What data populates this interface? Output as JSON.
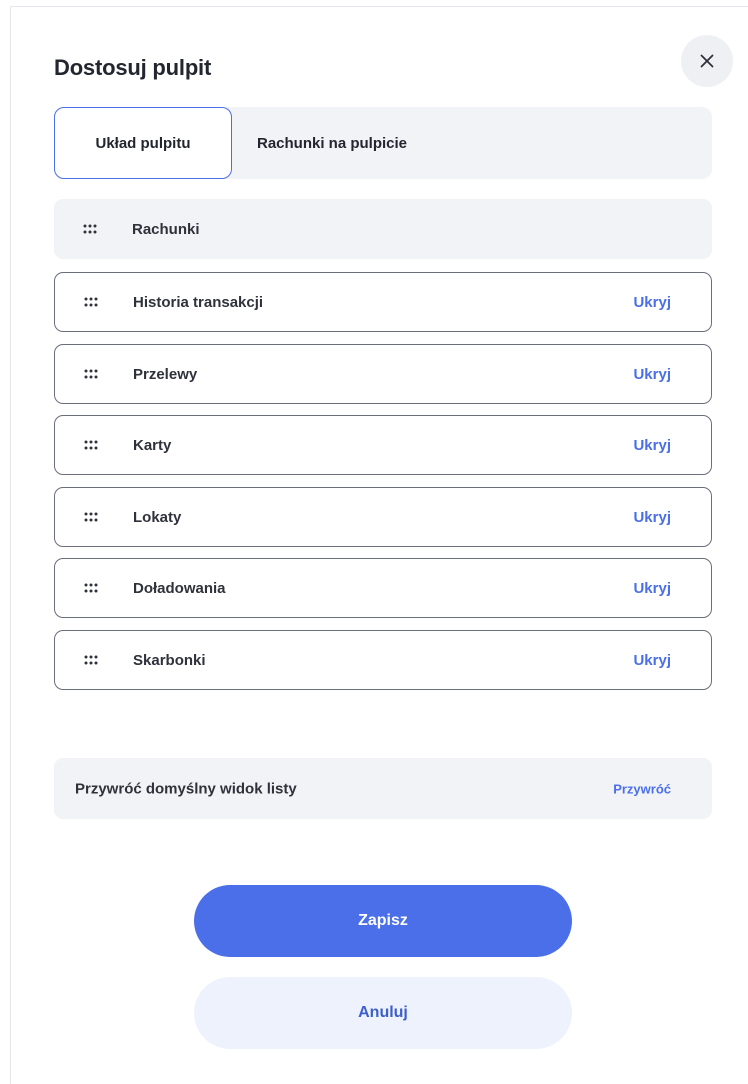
{
  "dialog": {
    "title": "Dostosuj pulpit"
  },
  "tabs": [
    {
      "label": "Układ pulpitu",
      "active": true
    },
    {
      "label": "Rachunki na pulpicie",
      "active": false
    }
  ],
  "widgets": {
    "fixed": {
      "label": "Rachunki"
    },
    "items": [
      {
        "label": "Historia transakcji",
        "action": "Ukryj"
      },
      {
        "label": "Przelewy",
        "action": "Ukryj"
      },
      {
        "label": "Karty",
        "action": "Ukryj"
      },
      {
        "label": "Lokaty",
        "action": "Ukryj"
      },
      {
        "label": "Doładowania",
        "action": "Ukryj"
      },
      {
        "label": "Skarbonki",
        "action": "Ukryj"
      }
    ]
  },
  "restore": {
    "label": "Przywróć domyślny widok listy",
    "action": "Przywróć"
  },
  "buttons": {
    "save": "Zapisz",
    "cancel": "Anuluj"
  },
  "colors": {
    "accent": "#4a6fe8",
    "text": "#23262f",
    "surface": "#f2f3f6"
  },
  "icons": {
    "close": "close-icon",
    "drag": "drag-handle-icon"
  }
}
